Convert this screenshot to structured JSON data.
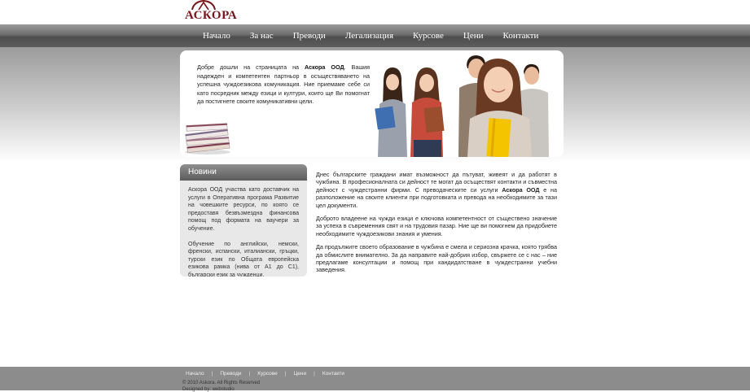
{
  "logo": {
    "text": "АСКОРА",
    "color": "#7a1419"
  },
  "nav": {
    "items": [
      "Начало",
      "За нас",
      "Преводи",
      "Легализация",
      "Курсове",
      "Цени",
      "Контакти"
    ]
  },
  "hero": {
    "text_before": "Добре дошли на страницата на ",
    "text_bold": "Аскора ООД",
    "text_after": ". Вашия надежден и компетентен партньор в осъществяването на успешна чуждоезикова комуникация. Ние приемаме себе си като посредник между езици и култури, които ще Ви помогнат да постигнете своите комуникативни цели."
  },
  "news": {
    "title": "Новини",
    "paragraphs": [
      "Аскора ООД участва като доставчик на услуги в Оперативна програма Развитие на човешките ресурси, по която се предоставя безвъзмездна финансова помощ под формата на ваучери за обучение.",
      "Обучение по английски, немски, френски, испански, италиански, гръцки, турски език по Общата европейска езикова рамка (нива от А1 до С1), български език за чужденци."
    ]
  },
  "main": {
    "p1_before": "Днес българските граждани имат възможност да пътуват, живеят и да работят в чужбина. В професионалната си дейност те могат да осъществят контакти и съвместна дейност с чуждестранни фирми. С преводаческите си услуги ",
    "p1_bold": "Аскора ООД",
    "p1_after": " е на разположение на своите клиенти при подготовката и превода на необходимите за тази цел документи.",
    "p2": "Доброто владеене на чужди езици е ключова компетентност от съществено значение за успеха в съвременния свят и на трудовия пазар. Ние ще ви помогнем да придобиете необходимите чуждоезикови знания и умения.",
    "p3": "Да продължите своето образование в чужбина е смела и сериозна крачка, която трябва да обмислите внимателно. За да направите най-добрия избор, свържете се с нас – ние предлагаме консултации и помощ при кандидатстване в чуждестранни учебни заведения."
  },
  "footer": {
    "links": [
      "Начало",
      "Преводи",
      "Курсове",
      "Цени",
      "Контакти"
    ],
    "separator": "|",
    "copyright": "© 2010 Askora. All Rights Reserved",
    "designed": "Designed by: webstudio"
  }
}
